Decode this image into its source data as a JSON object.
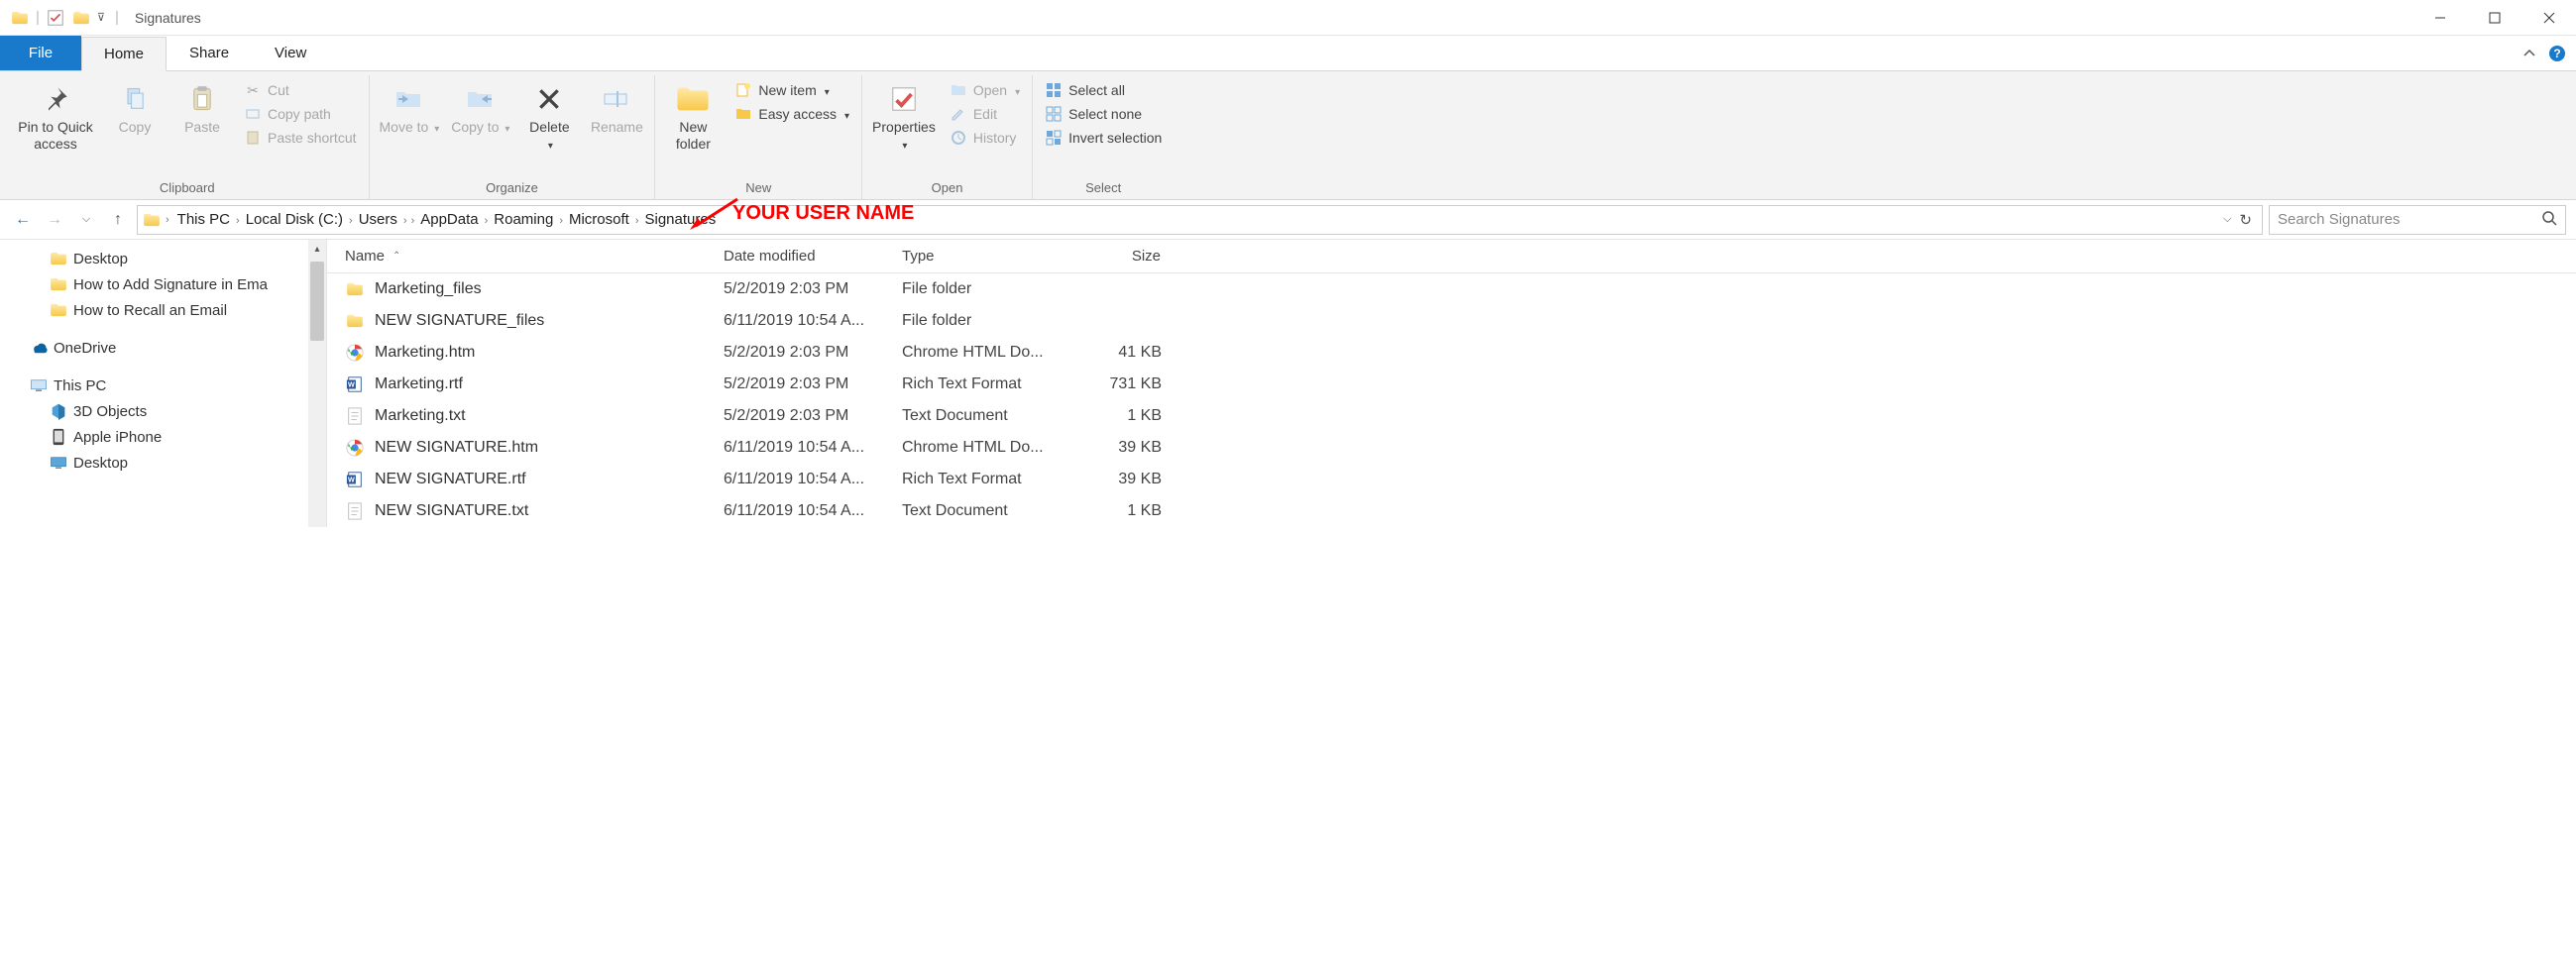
{
  "window": {
    "title": "Signatures"
  },
  "tabs": {
    "file": "File",
    "home": "Home",
    "share": "Share",
    "view": "View"
  },
  "ribbon": {
    "clipboard": {
      "label": "Clipboard",
      "pin": "Pin to Quick access",
      "copy": "Copy",
      "paste": "Paste",
      "cut": "Cut",
      "copy_path": "Copy path",
      "paste_shortcut": "Paste shortcut"
    },
    "organize": {
      "label": "Organize",
      "move_to": "Move to",
      "copy_to": "Copy to",
      "delete": "Delete",
      "rename": "Rename"
    },
    "new": {
      "label": "New",
      "new_folder": "New folder",
      "new_item": "New item",
      "easy_access": "Easy access"
    },
    "open": {
      "label": "Open",
      "properties": "Properties",
      "open": "Open",
      "edit": "Edit",
      "history": "History"
    },
    "select": {
      "label": "Select",
      "select_all": "Select all",
      "select_none": "Select none",
      "invert": "Invert selection"
    }
  },
  "breadcrumb": {
    "items": [
      "This PC",
      "Local Disk (C:)",
      "Users",
      "",
      "AppData",
      "Roaming",
      "Microsoft",
      "Signatures"
    ]
  },
  "annotation": "YOUR USER NAME",
  "search": {
    "placeholder": "Search Signatures"
  },
  "tree": {
    "items": [
      {
        "label": "Desktop",
        "depth": 1,
        "icon": "folder"
      },
      {
        "label": "How to Add Signature in Ema",
        "depth": 1,
        "icon": "folder"
      },
      {
        "label": "How to Recall an Email",
        "depth": 1,
        "icon": "folder"
      },
      {
        "sep": true
      },
      {
        "label": "OneDrive",
        "depth": 0,
        "icon": "onedrive"
      },
      {
        "sep": true
      },
      {
        "label": "This PC",
        "depth": 0,
        "icon": "thispc"
      },
      {
        "label": "3D Objects",
        "depth": 1,
        "icon": "3d"
      },
      {
        "label": "Apple iPhone",
        "depth": 1,
        "icon": "phone"
      },
      {
        "label": "Desktop",
        "depth": 1,
        "icon": "desktop"
      }
    ]
  },
  "columns": {
    "name": "Name",
    "date": "Date modified",
    "type": "Type",
    "size": "Size"
  },
  "files": [
    {
      "name": "Marketing_files",
      "date": "5/2/2019 2:03 PM",
      "type": "File folder",
      "size": "",
      "icon": "folder"
    },
    {
      "name": "NEW SIGNATURE_files",
      "date": "6/11/2019 10:54 A...",
      "type": "File folder",
      "size": "",
      "icon": "folder"
    },
    {
      "name": "Marketing.htm",
      "date": "5/2/2019 2:03 PM",
      "type": "Chrome HTML Do...",
      "size": "41 KB",
      "icon": "chrome"
    },
    {
      "name": "Marketing.rtf",
      "date": "5/2/2019 2:03 PM",
      "type": "Rich Text Format",
      "size": "731 KB",
      "icon": "word"
    },
    {
      "name": "Marketing.txt",
      "date": "5/2/2019 2:03 PM",
      "type": "Text Document",
      "size": "1 KB",
      "icon": "text"
    },
    {
      "name": "NEW SIGNATURE.htm",
      "date": "6/11/2019 10:54 A...",
      "type": "Chrome HTML Do...",
      "size": "39 KB",
      "icon": "chrome"
    },
    {
      "name": "NEW SIGNATURE.rtf",
      "date": "6/11/2019 10:54 A...",
      "type": "Rich Text Format",
      "size": "39 KB",
      "icon": "word"
    },
    {
      "name": "NEW SIGNATURE.txt",
      "date": "6/11/2019 10:54 A...",
      "type": "Text Document",
      "size": "1 KB",
      "icon": "text"
    }
  ]
}
